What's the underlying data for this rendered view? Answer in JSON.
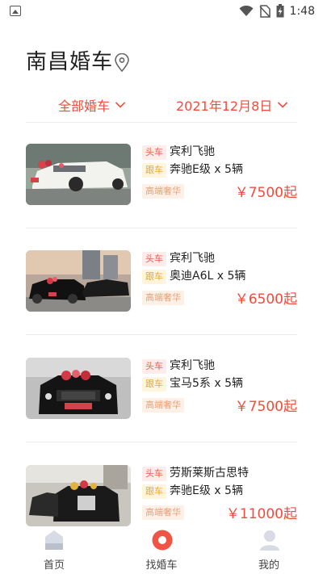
{
  "status_bar": {
    "time": "1:48"
  },
  "header": {
    "title": "南昌婚车"
  },
  "filters": {
    "category": "全部婚车",
    "date": "2021年12月8日"
  },
  "cars": [
    {
      "head_tag": "头车",
      "head_car": "宾利飞驰",
      "follow_tag": "跟车",
      "follow_car": "奔驰E级 x 5辆",
      "level_tag": "高端奢华",
      "price": "￥7500起"
    },
    {
      "head_tag": "头车",
      "head_car": "宾利飞驰",
      "follow_tag": "跟车",
      "follow_car": "奥迪A6L x 5辆",
      "level_tag": "高端奢华",
      "price": "￥6500起"
    },
    {
      "head_tag": "头车",
      "head_car": "宾利飞驰",
      "follow_tag": "跟车",
      "follow_car": "宝马5系 x 5辆",
      "level_tag": "高端奢华",
      "price": "￥7500起"
    },
    {
      "head_tag": "头车",
      "head_car": "劳斯莱斯古思特",
      "follow_tag": "跟车",
      "follow_car": "奔驰E级 x 5辆",
      "level_tag": "高端奢华",
      "price": "￥11000起"
    }
  ],
  "tabbar": [
    {
      "label": "首页",
      "icon": "home-icon"
    },
    {
      "label": "找婚车",
      "icon": "find-car-icon"
    },
    {
      "label": "我的",
      "icon": "profile-icon"
    }
  ],
  "colors": {
    "accent": "#ee4d3d",
    "head_tag_bg": "#fdecea",
    "follow_tag_text": "#e8a63a"
  }
}
